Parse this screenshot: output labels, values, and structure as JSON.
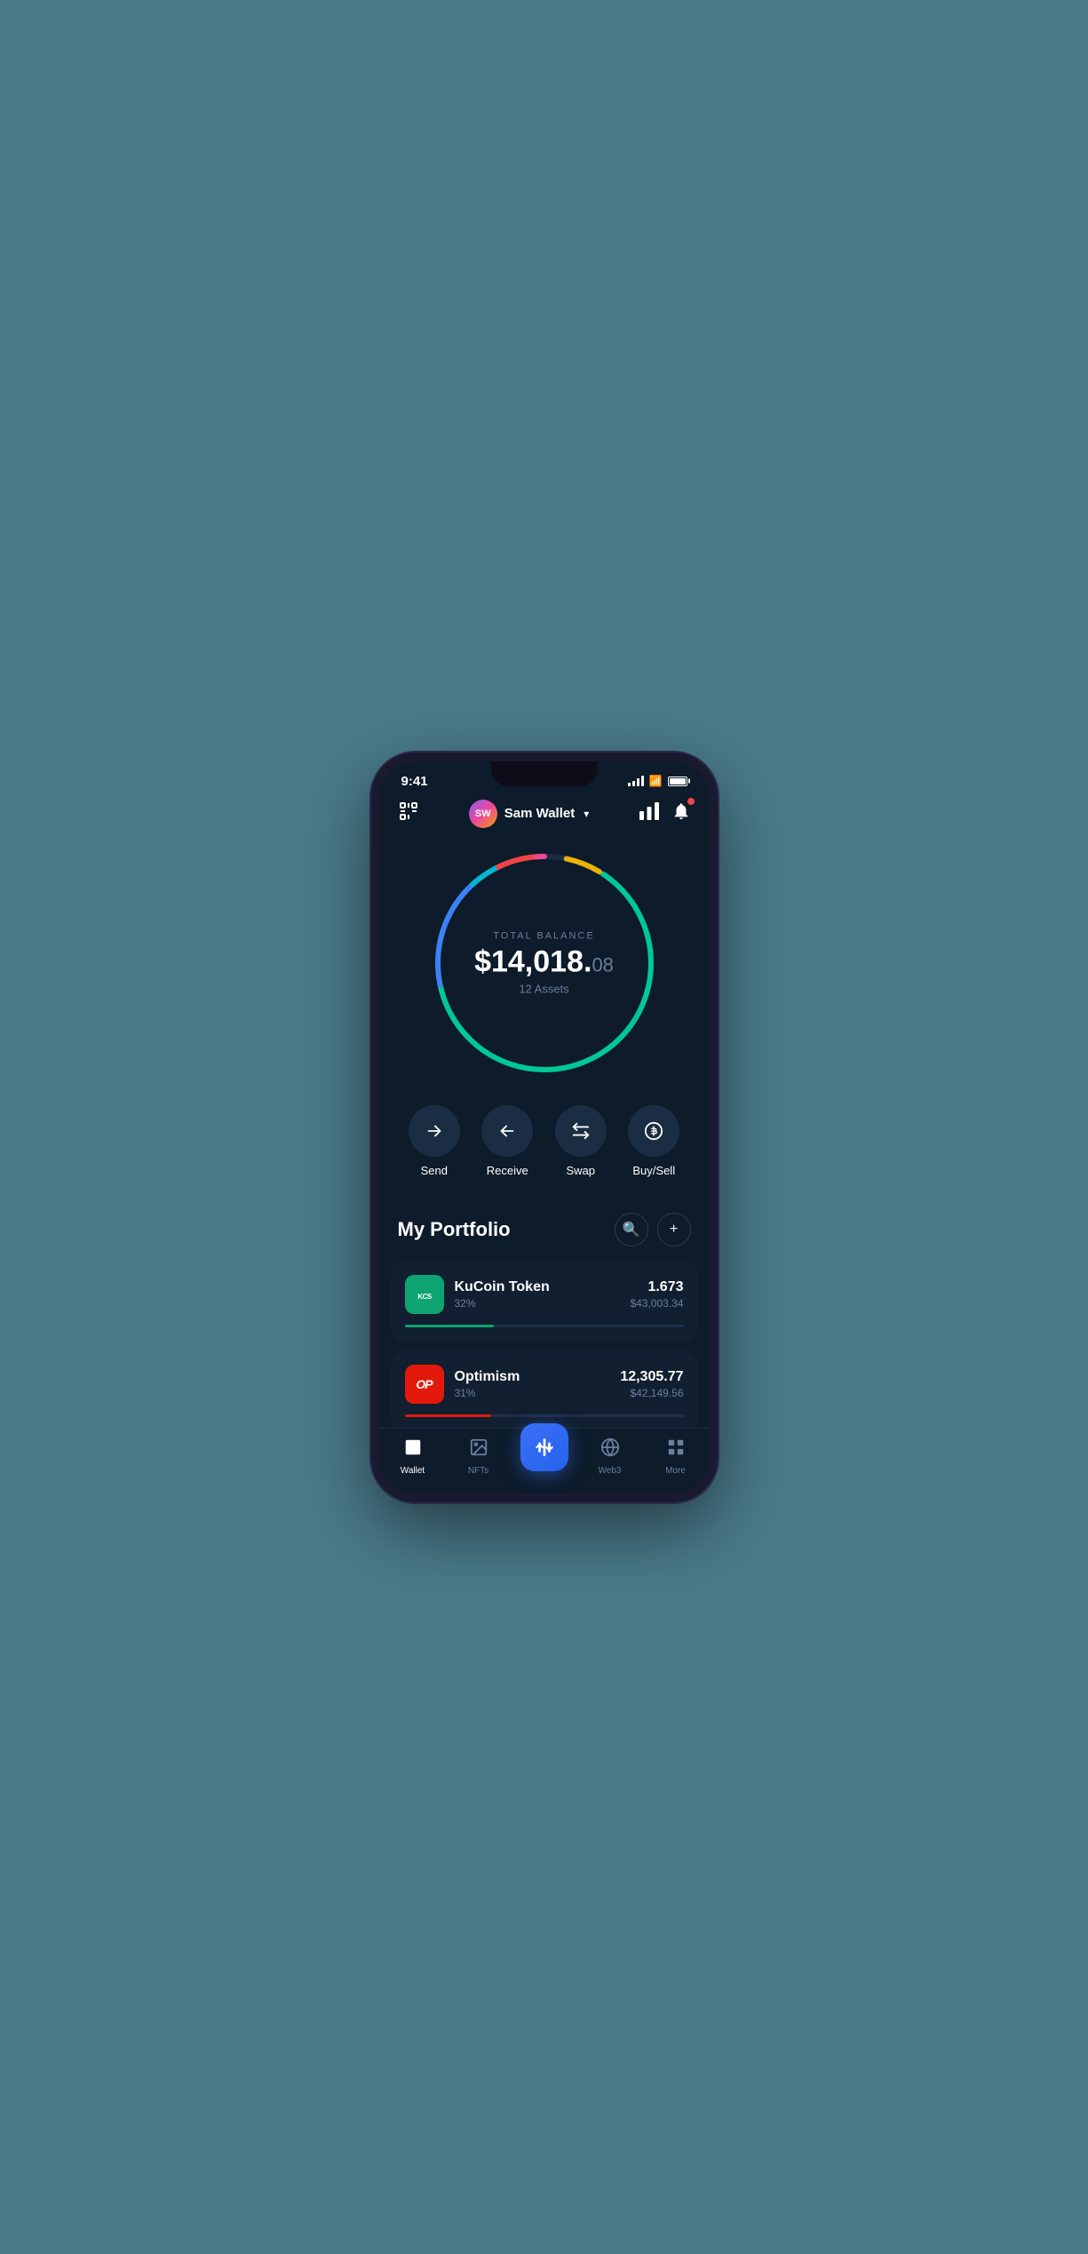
{
  "statusBar": {
    "time": "9:41",
    "battery": 100
  },
  "header": {
    "walletIcon": "⊡",
    "avatarText": "SW",
    "walletName": "Sam Wallet",
    "chartIcon": "📊",
    "bellIcon": "🔔"
  },
  "balance": {
    "label": "TOTAL BALANCE",
    "amountWhole": "$14,018.",
    "amountCents": "08",
    "assets": "12 Assets"
  },
  "actions": [
    {
      "id": "send",
      "icon": "→",
      "label": "Send"
    },
    {
      "id": "receive",
      "icon": "←",
      "label": "Receive"
    },
    {
      "id": "swap",
      "icon": "⇅",
      "label": "Swap"
    },
    {
      "id": "buysell",
      "icon": "$",
      "label": "Buy/Sell"
    }
  ],
  "portfolio": {
    "title": "My Portfolio",
    "searchLabel": "🔍",
    "addLabel": "+"
  },
  "assets": [
    {
      "id": "kucoin",
      "name": "KuCoin Token",
      "iconText": "KCS",
      "iconBg": "#0ea472",
      "percentage": "32%",
      "amount": "1.673",
      "usd": "$43,003.34",
      "barColor": "#0ea472",
      "barWidth": "32"
    },
    {
      "id": "optimism",
      "name": "Optimism",
      "iconText": "OP",
      "iconBg": "#e2190a",
      "percentage": "31%",
      "amount": "12,305.77",
      "usd": "$42,149.56",
      "barColor": "#e2190a",
      "barWidth": "31"
    }
  ],
  "bottomNav": [
    {
      "id": "wallet",
      "icon": "👛",
      "label": "Wallet",
      "active": true
    },
    {
      "id": "nfts",
      "icon": "🖼",
      "label": "NFTs",
      "active": false
    },
    {
      "id": "center",
      "icon": "⇅",
      "label": "",
      "active": false,
      "isCenter": true
    },
    {
      "id": "web3",
      "icon": "🌐",
      "label": "Web3",
      "active": false
    },
    {
      "id": "more",
      "icon": "⊞",
      "label": "More",
      "active": false
    }
  ]
}
